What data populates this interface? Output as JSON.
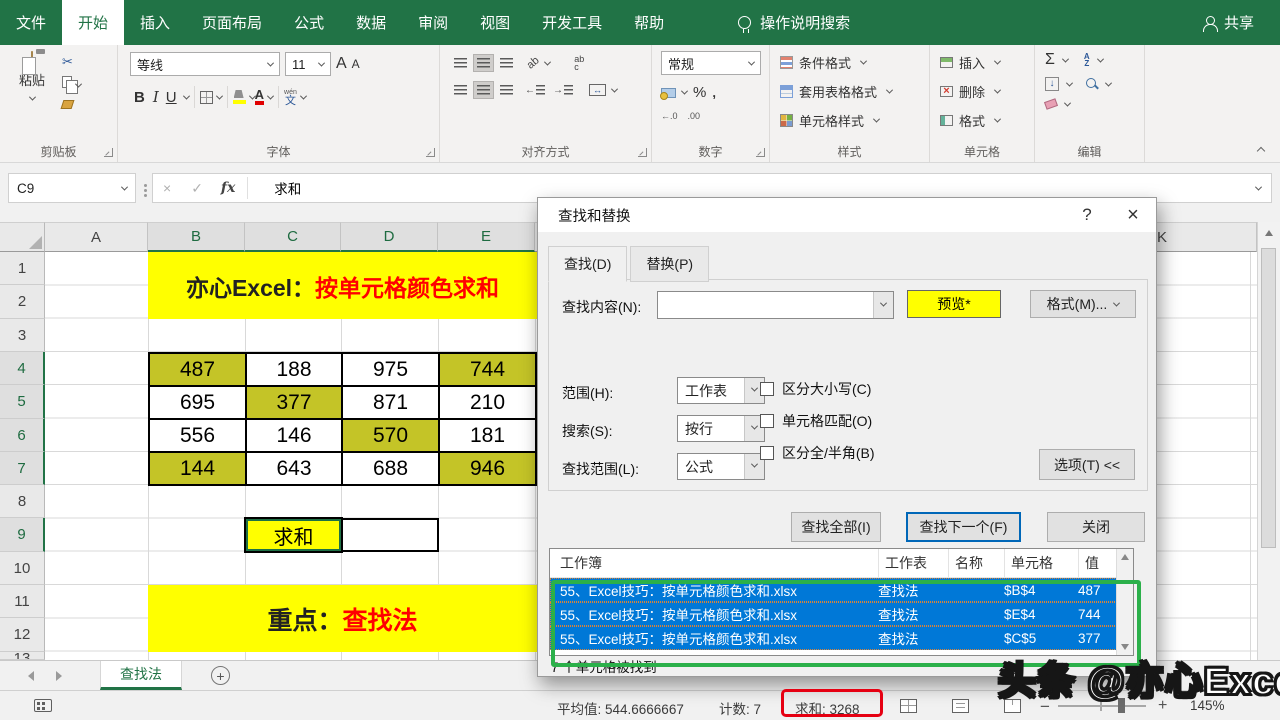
{
  "menu": {
    "tabs": [
      "文件",
      "开始",
      "插入",
      "页面布局",
      "公式",
      "数据",
      "审阅",
      "视图",
      "开发工具",
      "帮助"
    ],
    "search_label": "操作说明搜索",
    "share_label": "共享"
  },
  "ribbon": {
    "clipboard": {
      "paste": "粘贴",
      "label": "剪贴板"
    },
    "font": {
      "name": "等线",
      "size": "11",
      "grow": "A",
      "shrink": "A",
      "bold": "B",
      "italic": "I",
      "underline": "U",
      "color_letter": "A",
      "phonetic_top": "wén",
      "phonetic": "文",
      "label": "字体"
    },
    "alignment": {
      "orientation": "ab",
      "wrap_top": "ab",
      "wrap_bottom": "c",
      "merge_glyph": "↔",
      "indent_left": "←",
      "indent_right": "→",
      "label": "对齐方式"
    },
    "number": {
      "format": "常规",
      "percent": "%",
      "comma": ",",
      "inc_decimal": "←.0",
      "dec_decimal": ".00",
      "label": "数字"
    },
    "styles": {
      "items": [
        "条件格式",
        "套用表格格式",
        "单元格样式"
      ],
      "label": "样式"
    },
    "cells": {
      "items": [
        "插入",
        "删除",
        "格式"
      ],
      "delete_glyph": "×",
      "label": "单元格"
    },
    "editing": {
      "sigma": "Σ",
      "sort_a": "A",
      "sort_z": "Z",
      "fill_glyph": "↓",
      "label": "编辑"
    }
  },
  "icons": {
    "cut": "✂",
    "cancel": "×",
    "enter": "✓",
    "fx": "fx",
    "help": "?",
    "close": "×"
  },
  "formula_bar": {
    "name_box": "C9",
    "value": "求和"
  },
  "sheet": {
    "columns": [
      "A",
      "B",
      "C",
      "D",
      "E"
    ],
    "partial_column": "K",
    "rows": [
      "1",
      "2",
      "3",
      "4",
      "5",
      "6",
      "7",
      "8",
      "9",
      "10",
      "11",
      "12",
      "13"
    ],
    "title_banner": {
      "prefix": "亦心Excel：",
      "highlight": "按单元格颜色求和"
    },
    "focus_banner": {
      "prefix": "重点：",
      "highlight": "查找法"
    },
    "grid": [
      [
        "487",
        "188",
        "975",
        "744"
      ],
      [
        "695",
        "377",
        "871",
        "210"
      ],
      [
        "556",
        "146",
        "570",
        "181"
      ],
      [
        "144",
        "643",
        "688",
        "946"
      ]
    ],
    "sum_cell": "求和"
  },
  "dialog": {
    "title": "查找和替换",
    "tabs": [
      "查找(D)",
      "替换(P)"
    ],
    "find_what_label": "查找内容(N):",
    "preview_button": "预览*",
    "format_button": "格式(M)...",
    "fields": [
      {
        "label": "范围(H):",
        "value": "工作表"
      },
      {
        "label": "搜索(S):",
        "value": "按行"
      },
      {
        "label": "查找范围(L):",
        "value": "公式"
      }
    ],
    "checkboxes": [
      "区分大小写(C)",
      "单元格匹配(O)",
      "区分全/半角(B)"
    ],
    "options_button": "选项(T) <<",
    "find_all_button": "查找全部(I)",
    "find_next_button": "查找下一个(F)",
    "close_button": "关闭",
    "results": {
      "headers": [
        "工作簿",
        "工作表",
        "名称",
        "单元格",
        "值"
      ],
      "rows": [
        {
          "workbook": "55、Excel技巧：按单元格颜色求和.xlsx",
          "sheet": "查找法",
          "name": "",
          "cell": "$B$4",
          "value": "487"
        },
        {
          "workbook": "55、Excel技巧：按单元格颜色求和.xlsx",
          "sheet": "查找法",
          "name": "",
          "cell": "$E$4",
          "value": "744"
        },
        {
          "workbook": "55、Excel技巧：按单元格颜色求和.xlsx",
          "sheet": "查找法",
          "name": "",
          "cell": "$C$5",
          "value": "377"
        }
      ],
      "status": "7 个单元格被找到"
    }
  },
  "sheet_tabs": {
    "active": "查找法"
  },
  "status_bar": {
    "average": "平均值: 544.6666667",
    "count": "计数: 7",
    "sum": "求和: 3268",
    "zoom_level": "145%"
  },
  "watermark": {
    "text": "头条 @亦心Excel"
  },
  "colors": {
    "excel_green": "#217346",
    "highlight_fill": "#c4c427",
    "banner_yellow": "#ffff00",
    "banner_red": "#ff0000",
    "selection_blue": "#0078d7",
    "annotation_green": "#2bb04a",
    "annotation_red": "#e60012"
  }
}
